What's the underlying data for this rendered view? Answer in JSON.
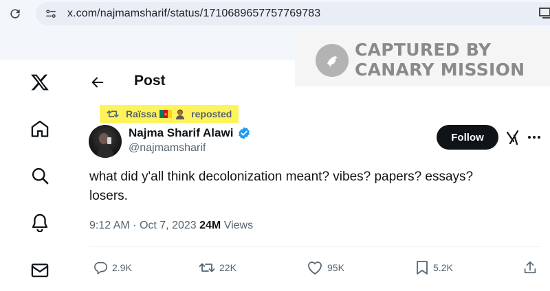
{
  "browser": {
    "url": "x.com/najmamsharif/status/1710689657757769783"
  },
  "watermark": {
    "line1": "CAPTURED BY",
    "line2": "CANARY MISSION"
  },
  "nav": {
    "items": [
      "x-logo",
      "home",
      "explore",
      "notifications",
      "messages"
    ]
  },
  "header": {
    "title": "Post"
  },
  "repost": {
    "name": "Raïssa",
    "suffix": "reposted"
  },
  "author": {
    "name": "Najma Sharif Alawi",
    "handle": "@najmamsharif",
    "verified": true
  },
  "follow_label": "Follow",
  "tweet": {
    "text_line1": "what did y'all think decolonization meant? vibes? papers? essays?",
    "text_line2": "losers."
  },
  "meta": {
    "time": "9:12 AM",
    "separator": "·",
    "date": "Oct 7, 2023",
    "views_count": "24M",
    "views_label": "Views"
  },
  "actions": {
    "replies": "2.9K",
    "reposts": "22K",
    "likes": "95K",
    "bookmarks": "5.2K"
  },
  "colors": {
    "highlight": "#fff35c",
    "verified_blue": "#1d9bf0",
    "text_primary": "#0f1419",
    "text_secondary": "#536471"
  }
}
